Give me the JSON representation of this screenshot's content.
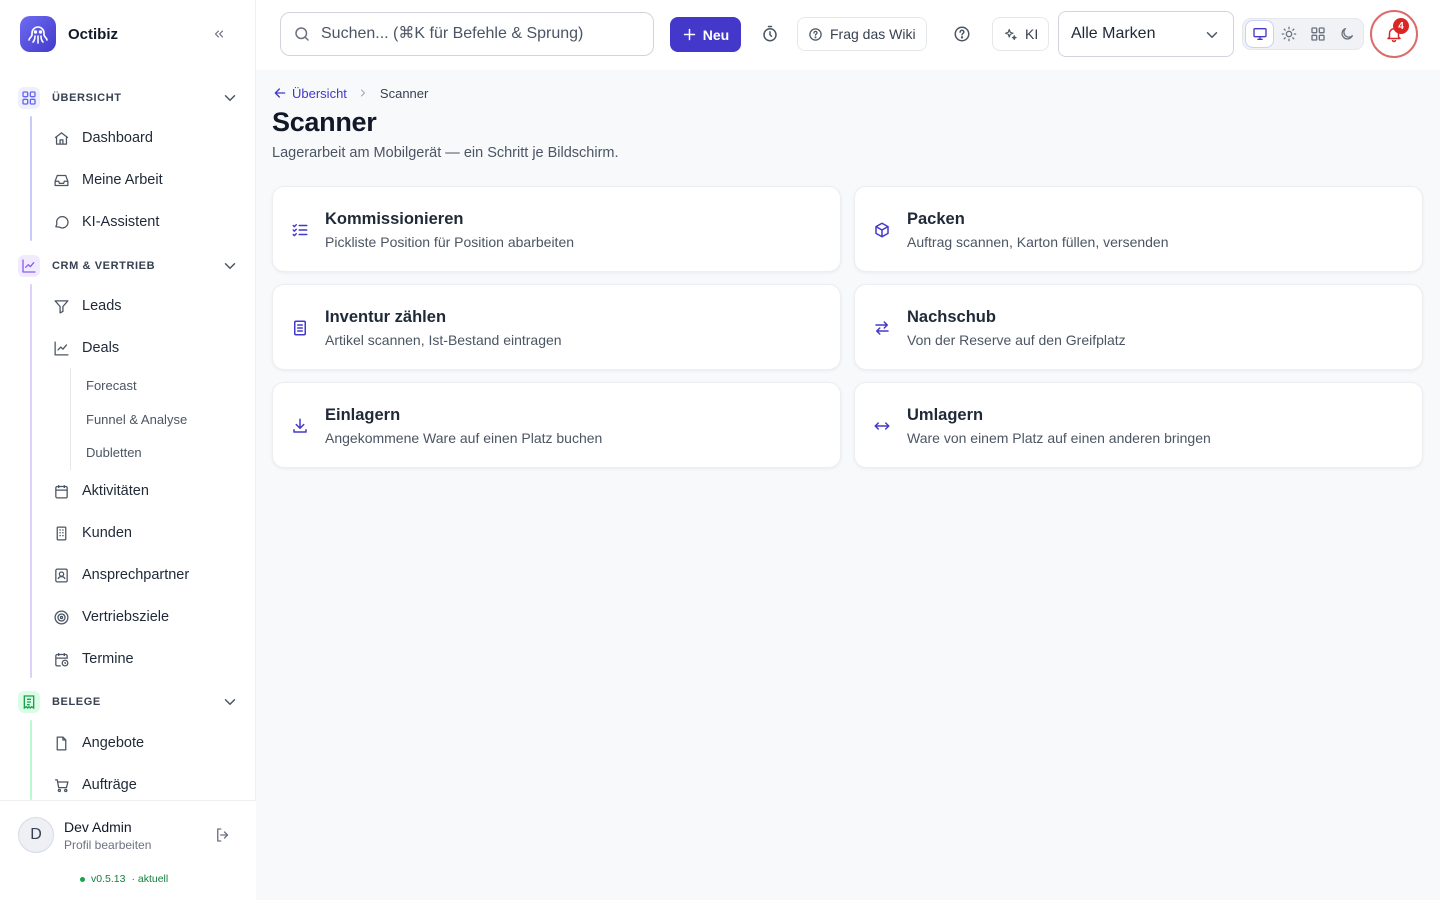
{
  "app": {
    "name": "Octibiz"
  },
  "search": {
    "placeholder": "Suchen... (⌘K für Befehle & Sprung)"
  },
  "topbar": {
    "new_label": "Neu",
    "wiki_label": "Frag das Wiki",
    "ki_label": "KI",
    "brand_filter": "Alle Marken",
    "notifications_count": "4",
    "theme_options": [
      "monitor-icon",
      "sun-icon",
      "grid-icon",
      "moon-icon"
    ],
    "active_theme": "monitor-icon"
  },
  "sidebar": {
    "sections": [
      {
        "label": "ÜBERSICHT",
        "color": "#6366f1",
        "items": [
          {
            "label": "Dashboard",
            "icon": "home-icon"
          },
          {
            "label": "Meine Arbeit",
            "icon": "inbox-icon"
          },
          {
            "label": "KI-Assistent",
            "icon": "chat-icon"
          }
        ]
      },
      {
        "label": "CRM & VERTRIEB",
        "color": "#8b5cf6",
        "items": [
          {
            "label": "Leads",
            "icon": "filter-icon"
          },
          {
            "label": "Deals",
            "icon": "trend-icon"
          },
          {
            "label": "Aktivitäten",
            "icon": "calendar-icon"
          },
          {
            "label": "Kunden",
            "icon": "building-icon"
          },
          {
            "label": "Ansprechpartner",
            "icon": "contact-icon"
          },
          {
            "label": "Vertriebsziele",
            "icon": "target-icon"
          },
          {
            "label": "Termine",
            "icon": "calendar-clock-icon"
          }
        ],
        "sub_items": [
          "Forecast",
          "Funnel & Analyse",
          "Dubletten"
        ]
      },
      {
        "label": "BELEGE",
        "color": "#22c55e",
        "items": [
          {
            "label": "Angebote",
            "icon": "file-icon"
          },
          {
            "label": "Aufträge",
            "icon": "cart-icon"
          }
        ]
      }
    ]
  },
  "user": {
    "initial": "D",
    "name": "Dev Admin",
    "sub": "Profil bearbeiten",
    "version": "v0.5.13",
    "version_status": "· aktuell"
  },
  "breadcrumb": {
    "back": "Übersicht",
    "current": "Scanner"
  },
  "page": {
    "title": "Scanner",
    "subtitle": "Lagerarbeit am Mobilgerät — ein Schritt je Bildschirm."
  },
  "cards": [
    {
      "title": "Kommissionieren",
      "desc": "Pickliste Position für Position abarbeiten",
      "icon": "list-check-icon"
    },
    {
      "title": "Packen",
      "desc": "Auftrag scannen, Karton füllen, versenden",
      "icon": "box-icon"
    },
    {
      "title": "Inventur zählen",
      "desc": "Artikel scannen, Ist-Bestand eintragen",
      "icon": "clipboard-icon"
    },
    {
      "title": "Nachschub",
      "desc": "Von der Reserve auf den Greifplatz",
      "icon": "swap-icon"
    },
    {
      "title": "Einlagern",
      "desc": "Angekommene Ware auf einen Platz buchen",
      "icon": "download-icon"
    },
    {
      "title": "Umlagern",
      "desc": "Ware von einem Platz auf einen anderen bringen",
      "icon": "arrows-horizontal-icon"
    }
  ],
  "colors": {
    "accent": "#4338ca",
    "notification": "#dc2626",
    "status_ok": "#16a34a"
  }
}
